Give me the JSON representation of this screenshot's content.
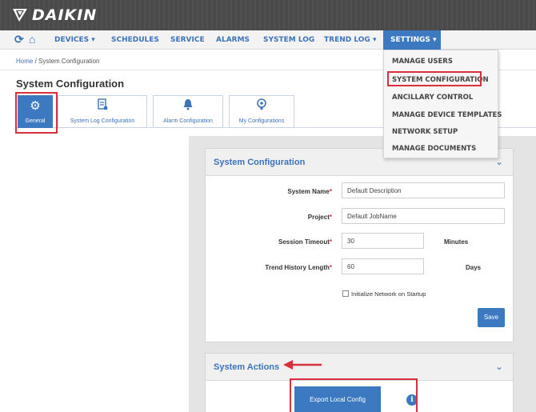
{
  "brand": {
    "name": "DAIKIN"
  },
  "nav": {
    "refresh_icon": "refresh-icon",
    "home_icon": "home-icon",
    "items": [
      {
        "label": "DEVICES ▾"
      },
      {
        "label": "SCHEDULES"
      },
      {
        "label": "SERVICE"
      },
      {
        "label": "ALARMS"
      },
      {
        "label": "SYSTEM LOG"
      },
      {
        "label": "TREND LOG ▾"
      }
    ],
    "settings_label": "SETTINGS ▾"
  },
  "breadcrumb": {
    "home": "Home",
    "separator": " / ",
    "current": "System Configuration"
  },
  "page_title": "System Configuration",
  "tabs": [
    {
      "label": "General",
      "icon": "gear-icon",
      "active": true
    },
    {
      "label": "System Log Configuration",
      "icon": "log-config-icon"
    },
    {
      "label": "Alarm Configuration",
      "icon": "bell-icon"
    },
    {
      "label": "My Configurations",
      "icon": "user-gear-icon"
    }
  ],
  "settings_menu": [
    {
      "label": "MANAGE USERS"
    },
    {
      "label": "SYSTEM CONFIGURATION",
      "highlighted": true
    },
    {
      "label": "ANCILLARY CONTROL"
    },
    {
      "label": "MANAGE DEVICE TEMPLATES"
    },
    {
      "label": "NETWORK SETUP"
    },
    {
      "label": "MANAGE DOCUMENTS"
    }
  ],
  "config_panel": {
    "title": "System Configuration",
    "fields": {
      "system_name": {
        "label": "System Name",
        "required_mark": "*",
        "value": "Default Description"
      },
      "project": {
        "label": "Project",
        "required_mark": "*",
        "value": "Default JobName"
      },
      "session_timeout": {
        "label": "Session Timeout",
        "required_mark": "*",
        "value": "30",
        "unit": "Minutes"
      },
      "trend_history": {
        "label": "Trend History Length",
        "required_mark": "*",
        "value": "60",
        "unit": "Days"
      }
    },
    "checkbox_label": "Initialize Network on Startup",
    "save_label": "Save"
  },
  "actions_panel": {
    "title": "System Actions",
    "export_label": "Export Local Config",
    "info_glyph": "i"
  },
  "colors": {
    "accent": "#3c79c0",
    "highlight": "#d9303e",
    "brandbar": "#4a4a4a"
  }
}
